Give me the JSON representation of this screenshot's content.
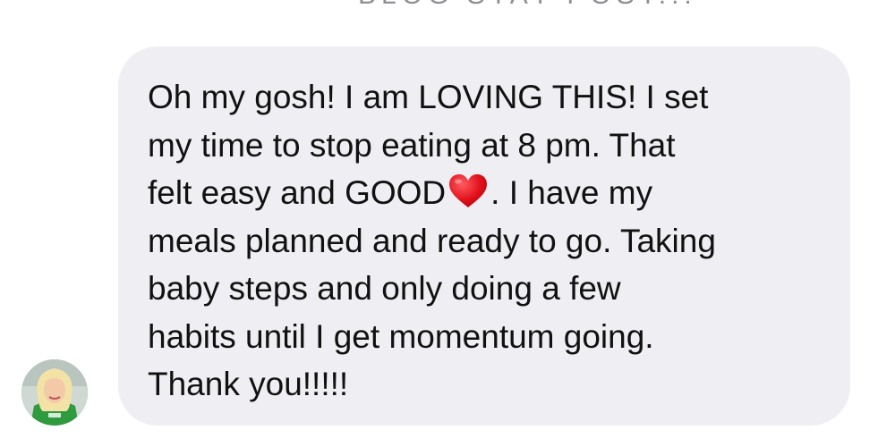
{
  "thread": {
    "previous_message_fragment": "BLOG STAY POST..."
  },
  "message": {
    "sender_avatar": "profile-photo",
    "lines": [
      "Oh my gosh!  I am LOVING THIS!  I set",
      "my time to stop eating at 8 pm. That",
      "felt easy and GOOD",
      ". I have my",
      "meals planned and ready to go. Taking",
      "baby steps and only doing a few",
      "habits until I get momentum going.",
      "Thank you!!!!!"
    ],
    "emoji": "heart-icon",
    "bubble_color": "#efeff3",
    "heart_color": "#e0111b"
  }
}
